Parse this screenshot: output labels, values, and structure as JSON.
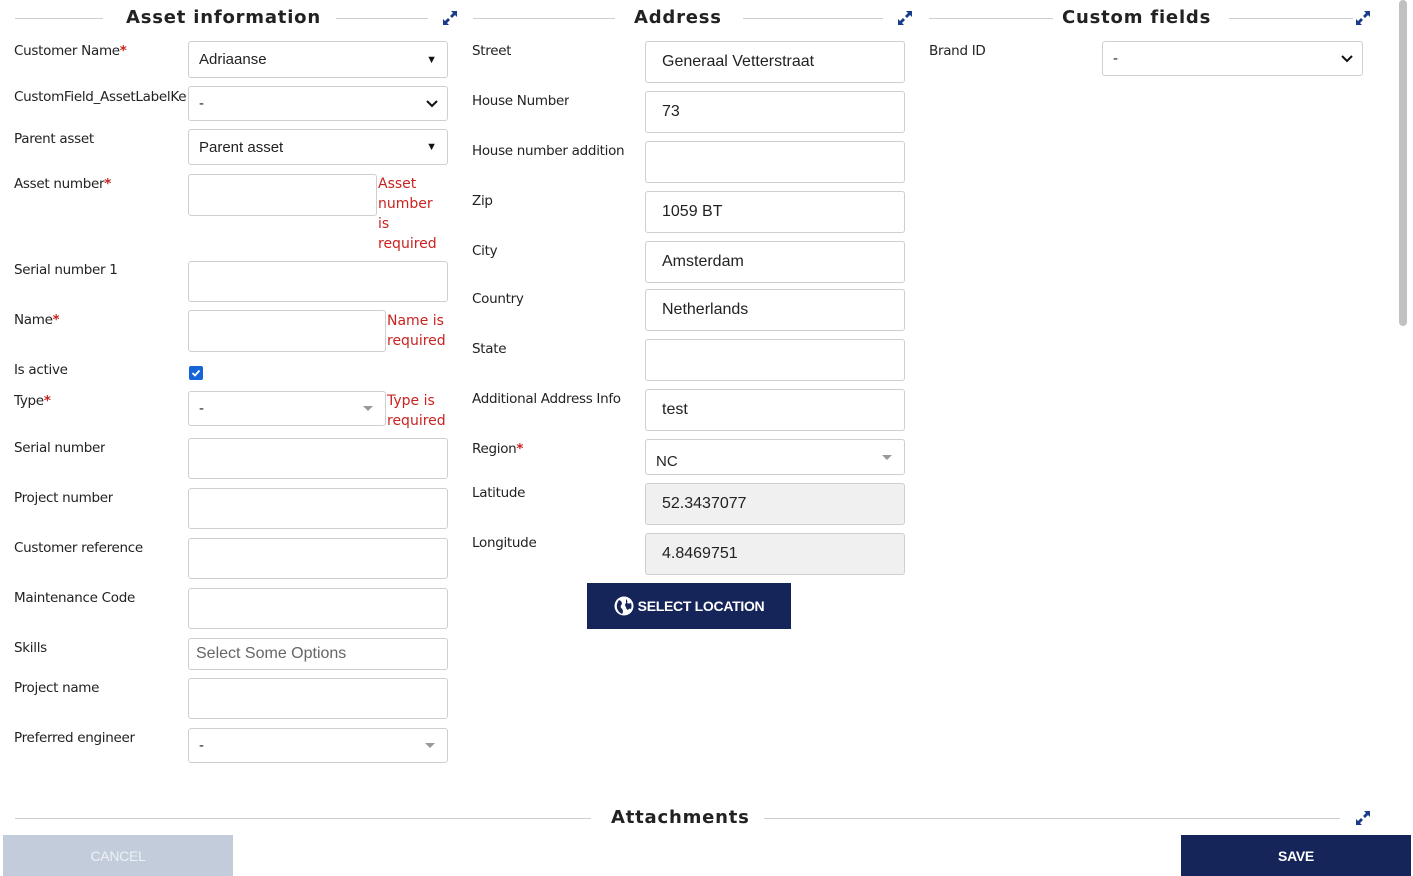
{
  "sections": {
    "asset_information": "Asset information",
    "address": "Address",
    "custom_fields": "Custom fields",
    "attachments": "Attachments"
  },
  "asset": {
    "customer_name_label": "Customer Name",
    "customer_name_value": "Adriaanse",
    "custom_field_label": "CustomField_AssetLabelKe",
    "custom_field_value": "-",
    "parent_asset_label": "Parent asset",
    "parent_asset_value": "Parent asset",
    "asset_number_label": "Asset number",
    "asset_number_error": "Asset number is required",
    "serial_number_1_label": "Serial number 1",
    "name_label": "Name",
    "name_error": "Name is required",
    "is_active_label": "Is active",
    "is_active_checked": true,
    "type_label": "Type",
    "type_value": "-",
    "type_error": "Type is required",
    "serial_number_label": "Serial number",
    "project_number_label": "Project number",
    "customer_reference_label": "Customer reference",
    "maintenance_code_label": "Maintenance Code",
    "skills_label": "Skills",
    "skills_placeholder": "Select Some Options",
    "project_name_label": "Project name",
    "preferred_engineer_label": "Preferred engineer",
    "preferred_engineer_value": "-"
  },
  "address": {
    "street_label": "Street",
    "street_value": "Generaal Vetterstraat",
    "house_number_label": "House Number",
    "house_number_value": "73",
    "house_number_addition_label": "House number addition",
    "zip_label": "Zip",
    "zip_value": "1059 BT",
    "city_label": "City",
    "city_value": "Amsterdam",
    "country_label": "Country",
    "country_value": "Netherlands",
    "state_label": "State",
    "additional_info_label": "Additional Address Info",
    "additional_info_value": "test",
    "region_label": "Region",
    "region_value": "NC",
    "latitude_label": "Latitude",
    "latitude_value": "52.3437077",
    "longitude_label": "Longitude",
    "longitude_value": "4.8469751",
    "select_location_label": "SELECT LOCATION"
  },
  "custom": {
    "brand_id_label": "Brand ID",
    "brand_id_value": "-"
  },
  "footer": {
    "cancel_label": "CANCEL",
    "save_label": "SAVE"
  },
  "required_marker": "*",
  "colors": {
    "primary": "#15255a",
    "error": "#c9231f",
    "checkbox": "#1565d8",
    "expand_icon": "#1a3a8a"
  },
  "icons": [
    "expand-icon",
    "globe-icon",
    "caret-down-icon",
    "chevron-down-icon",
    "check-icon"
  ]
}
